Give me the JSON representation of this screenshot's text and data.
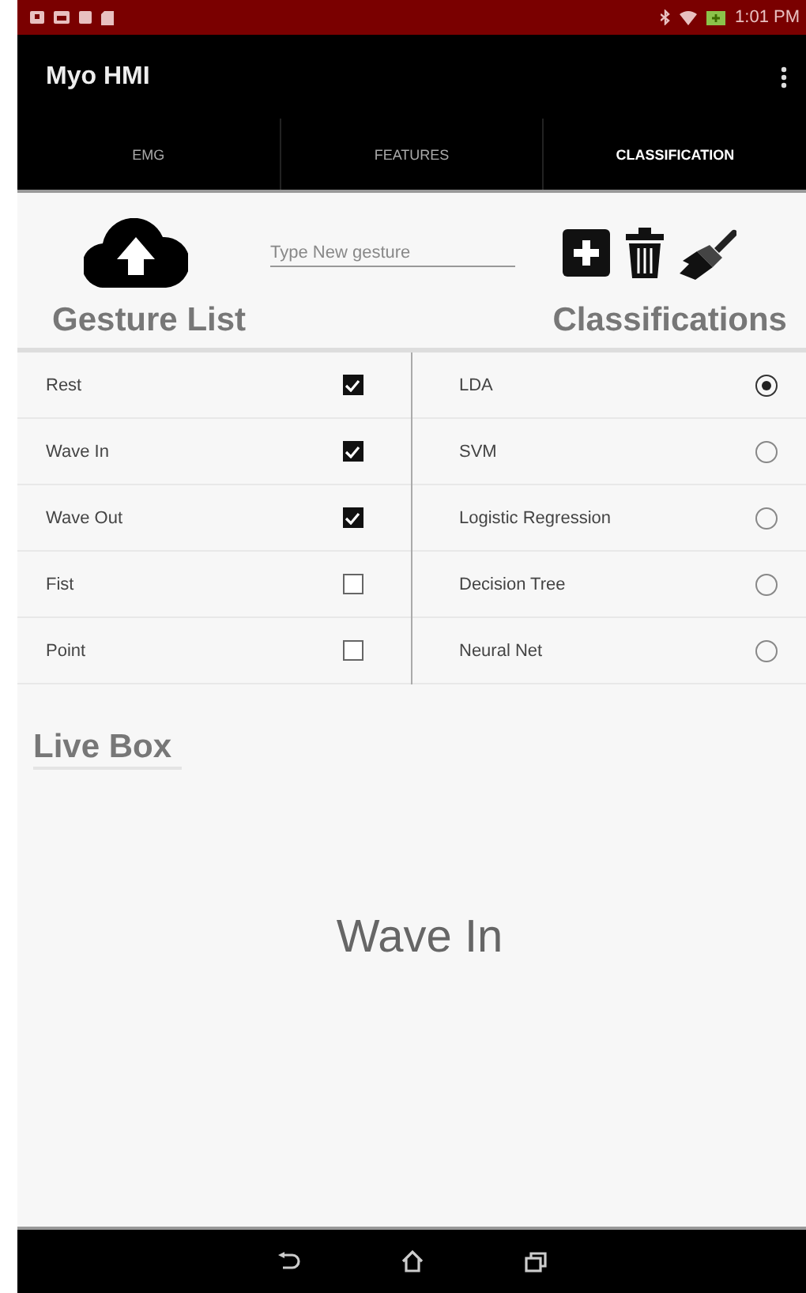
{
  "status_bar": {
    "time": "1:01 PM"
  },
  "app_bar": {
    "title": "Myo HMI"
  },
  "tabs": [
    {
      "label": "EMG",
      "selected": false
    },
    {
      "label": "FEATURES",
      "selected": false
    },
    {
      "label": "CLASSIFICATION",
      "selected": true
    }
  ],
  "gesture_field": {
    "placeholder": "Type New gesture"
  },
  "gesture_list": {
    "title": "Gesture List",
    "items": [
      {
        "label": "Rest",
        "checked": true
      },
      {
        "label": "Wave In",
        "checked": true
      },
      {
        "label": "Wave Out",
        "checked": true
      },
      {
        "label": "Fist",
        "checked": false
      },
      {
        "label": "Point",
        "checked": false
      }
    ]
  },
  "classifications": {
    "title": "Classifications",
    "items": [
      {
        "label": "LDA",
        "selected": true
      },
      {
        "label": "SVM",
        "selected": false
      },
      {
        "label": "Logistic Regression",
        "selected": false
      },
      {
        "label": "Decision Tree",
        "selected": false
      },
      {
        "label": "Neural Net",
        "selected": false
      }
    ]
  },
  "live_box": {
    "title": "Live Box",
    "result": "Wave In"
  }
}
